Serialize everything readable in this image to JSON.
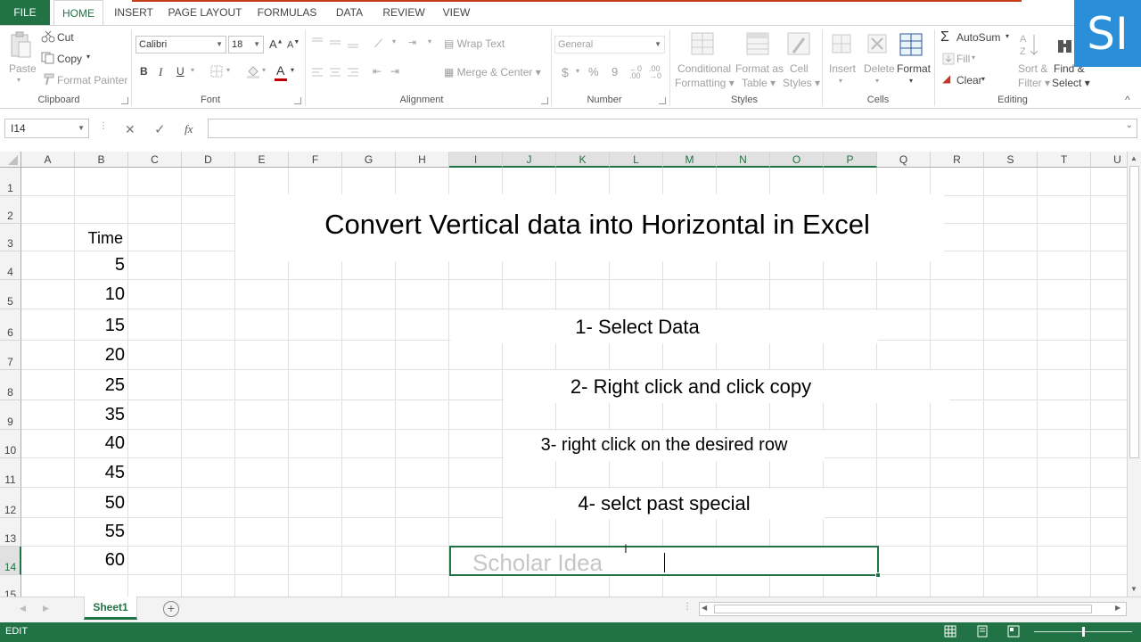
{
  "tabs": [
    "FILE",
    "HOME",
    "INSERT",
    "PAGE LAYOUT",
    "FORMULAS",
    "DATA",
    "REVIEW",
    "VIEW"
  ],
  "active_tab": "HOME",
  "ribbon": {
    "clipboard": {
      "label": "Clipboard",
      "paste": "Paste",
      "cut": "Cut",
      "copy": "Copy",
      "format_painter": "Format Painter"
    },
    "font": {
      "label": "Font",
      "font_name": "Calibri",
      "font_size": "18",
      "bold": "B",
      "italic": "I",
      "underline": "U",
      "font_color_letter": "A"
    },
    "alignment": {
      "label": "Alignment",
      "wrap_text": "Wrap Text",
      "merge_center": "Merge & Center"
    },
    "number": {
      "label": "Number",
      "format": "General",
      "currency": "$",
      "percent": "%",
      "comma": "9"
    },
    "styles": {
      "label": "Styles",
      "conditional_formatting": [
        "Conditional",
        "Formatting"
      ],
      "format_as_table": [
        "Format as",
        "Table"
      ],
      "cell_styles": [
        "Cell",
        "Styles"
      ]
    },
    "cells": {
      "label": "Cells",
      "insert": "Insert",
      "delete": "Delete",
      "format": "Format"
    },
    "editing": {
      "label": "Editing",
      "autosum": "AutoSum",
      "fill": "Fill",
      "clear": "Clear",
      "sort_filter": [
        "Sort &",
        "Filter"
      ],
      "find_select": [
        "Find &",
        "Select"
      ]
    }
  },
  "logo_text": "SI",
  "formula_bar": {
    "name_box": "I14",
    "cancel": "✕",
    "enter": "✓",
    "fx": "fx",
    "value": ""
  },
  "columns": [
    "A",
    "B",
    "C",
    "D",
    "E",
    "F",
    "G",
    "H",
    "I",
    "J",
    "K",
    "L",
    "M",
    "N",
    "O",
    "P",
    "Q",
    "R",
    "S",
    "T",
    "U"
  ],
  "selected_columns": [
    "I",
    "J",
    "K",
    "L",
    "M",
    "N",
    "O",
    "P"
  ],
  "rows": [
    "1",
    "2",
    "3",
    "4",
    "5",
    "6",
    "7",
    "8",
    "9",
    "10",
    "11",
    "12",
    "13",
    "14",
    "15"
  ],
  "selected_row": "14",
  "column_b": {
    "header": "Time",
    "values": [
      "5",
      "10",
      "15",
      "20",
      "25",
      "35",
      "40",
      "45",
      "50",
      "55",
      "60"
    ]
  },
  "title": "Convert Vertical data into Horizontal in Excel",
  "steps": [
    "1- Select Data",
    "2- Right click and click copy",
    "3- right click on the desired row",
    "4- selct past special"
  ],
  "watermark": "Scholar Idea",
  "sheet_tab": "Sheet1",
  "status": {
    "mode": "EDIT"
  },
  "colors": {
    "excel_green": "#217346",
    "logo_blue": "#2a8fd8",
    "file_tab": "#217346"
  }
}
